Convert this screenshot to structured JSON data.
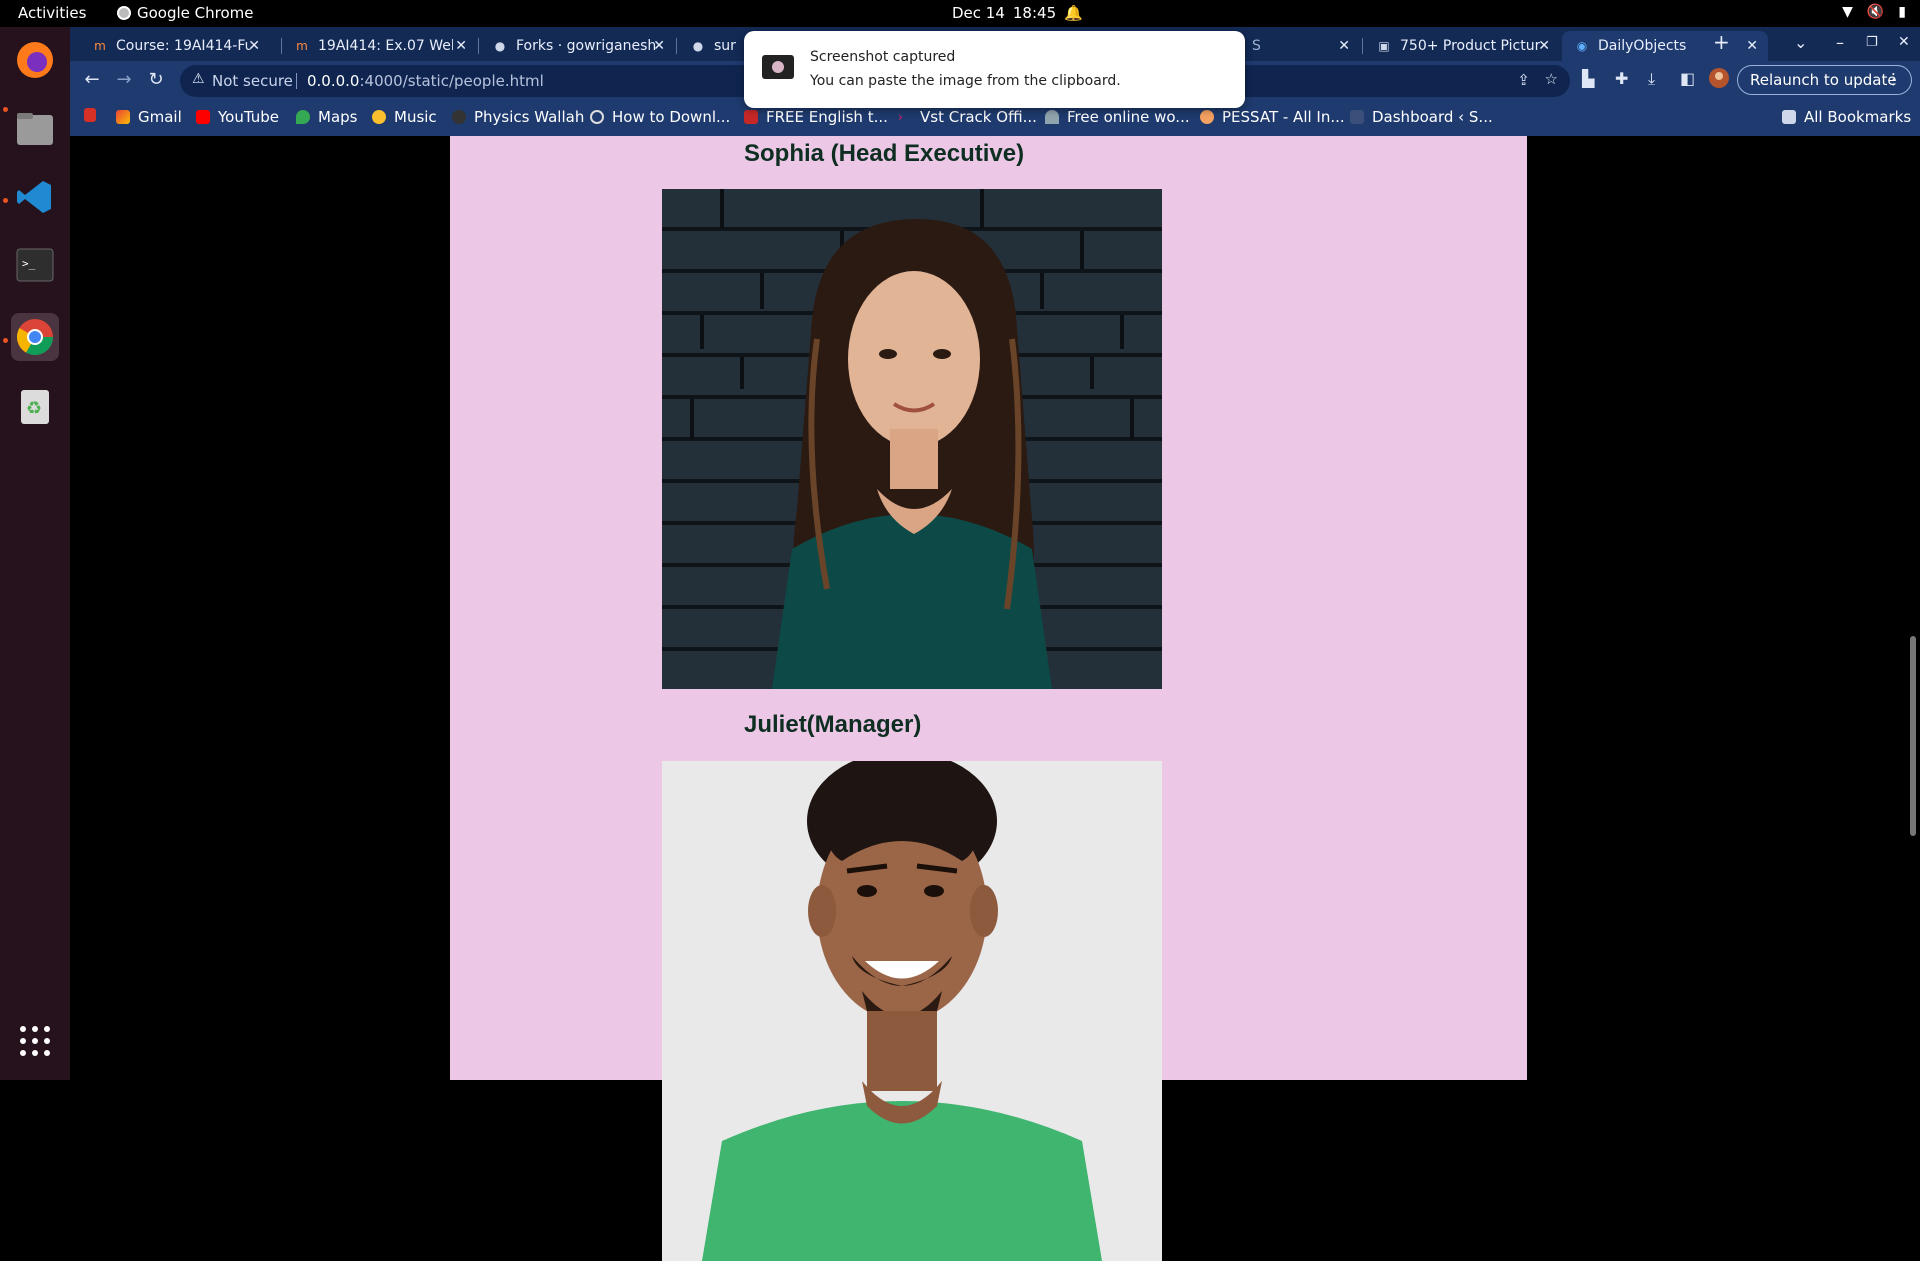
{
  "system": {
    "activities": "Activities",
    "app_name": "Google Chrome",
    "date": "Dec 14",
    "time": "18:45"
  },
  "tabs": [
    {
      "title": "Course: 19AI414-Fu"
    },
    {
      "title": "19AI414: Ex.07 Web"
    },
    {
      "title": "Forks · gowriganesh"
    },
    {
      "title": "sur"
    },
    {
      "title": "S"
    },
    {
      "title": "750+ Product Pictur"
    },
    {
      "title": "DailyObjects"
    }
  ],
  "toolbar": {
    "security": "Not secure",
    "url_host": "0.0.0.0",
    "url_path": ":4000/static/people.html",
    "relaunch": "Relaunch to update"
  },
  "bookmarks": [
    {
      "label": "Gmail"
    },
    {
      "label": "YouTube"
    },
    {
      "label": "Maps"
    },
    {
      "label": "Music"
    },
    {
      "label": "Physics Wallah"
    },
    {
      "label": "How to Downl..."
    },
    {
      "label": "FREE English t..."
    },
    {
      "label": "Vst Crack Offi..."
    },
    {
      "label": "Free online wo..."
    },
    {
      "label": "PESSAT - All In..."
    },
    {
      "label": "Dashboard ‹ S..."
    },
    {
      "label": "All Bookmarks"
    }
  ],
  "notification": {
    "title": "Screenshot captured",
    "body": "You can paste the image from the clipboard."
  },
  "people": [
    {
      "name": "Sophia (Head Executive)"
    },
    {
      "name": "Juliet(Manager)"
    }
  ]
}
